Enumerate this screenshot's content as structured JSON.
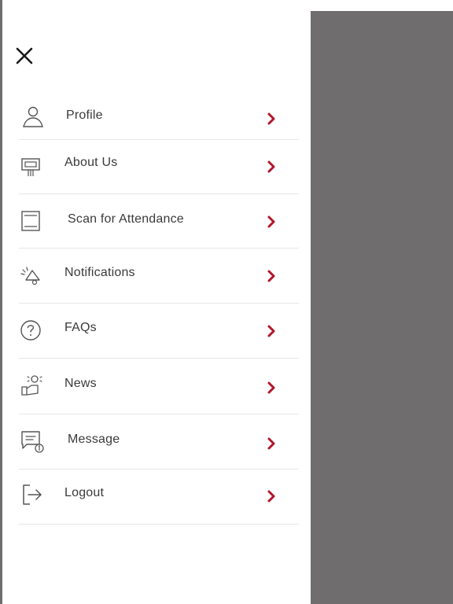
{
  "drawer": {
    "close_icon": "close-icon",
    "items": [
      {
        "label": "Profile",
        "icon": "user-icon"
      },
      {
        "label": "About Us",
        "icon": "kiosk-icon"
      },
      {
        "label": "Scan for Attendance",
        "icon": "scan-frame-icon"
      },
      {
        "label": "Notifications",
        "icon": "megaphone-icon"
      },
      {
        "label": "FAQs",
        "icon": "question-icon"
      },
      {
        "label": "News",
        "icon": "news-icon"
      },
      {
        "label": "Message",
        "icon": "message-icon"
      },
      {
        "label": "Logout",
        "icon": "logout-icon"
      }
    ]
  },
  "colors": {
    "accent": "#b0182c",
    "overlay": "#6f6d6e",
    "text": "#3a3a3a",
    "divider": "#e7e7e7"
  }
}
